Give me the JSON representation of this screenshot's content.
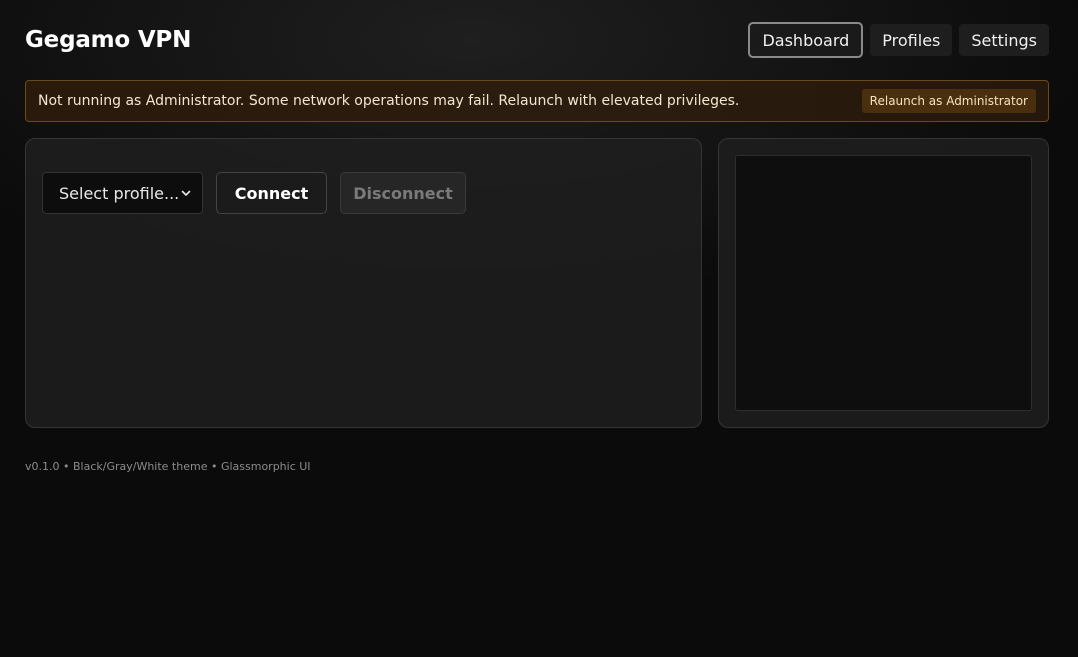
{
  "header": {
    "title": "Gegamo VPN"
  },
  "nav": {
    "tabs": [
      {
        "label": "Dashboard",
        "active": true
      },
      {
        "label": "Profiles",
        "active": false
      },
      {
        "label": "Settings",
        "active": false
      }
    ]
  },
  "warning": {
    "message": "Not running as Administrator. Some network operations may fail. Relaunch with elevated privileges.",
    "action_label": "Relaunch as Administrator"
  },
  "controls": {
    "profile_select_value": "Select profile...",
    "connect_label": "Connect",
    "disconnect_label": "Disconnect",
    "disconnect_enabled": false
  },
  "footer": {
    "text": "v0.1.0 • Black/Gray/White theme • Glassmorphic UI"
  },
  "icons": {
    "select_indicator": "chevron-down-icon"
  },
  "colors": {
    "background": "#0b0b0b",
    "warning_border": "#6b4a1a",
    "warning_button": "#4a2f0f",
    "active_tab_border": "#8a8a8a"
  }
}
